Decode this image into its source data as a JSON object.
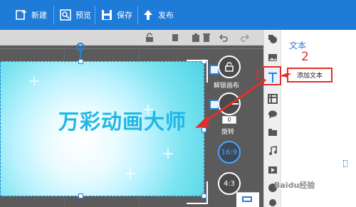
{
  "toolbar": {
    "new_label": "新建",
    "preview_label": "预览",
    "save_label": "保存",
    "publish_label": "发布",
    "bg_color": "#1e7bd8"
  },
  "canvas": {
    "title_text": "万彩动画大师",
    "title_color": "#20b7e3"
  },
  "controls": {
    "unlock_canvas_label": "解锁画布",
    "rotate_value": "0",
    "rotate_label": "旋转",
    "ratio_16_9": "16:9",
    "ratio_4_3": "4:3"
  },
  "panel": {
    "title": "文本",
    "add_text_label": "添加文本"
  },
  "annotations": {
    "num1": "1",
    "num2": "2",
    "color": "#e0302b"
  },
  "watermark": "Baidu经验",
  "icons": [
    "new-icon",
    "preview-icon",
    "save-icon",
    "publish-icon",
    "lock-icon",
    "copy-icon",
    "paste-icon",
    "delete-icon",
    "undo-icon",
    "redo-icon",
    "shape-icon",
    "image-icon",
    "text-icon",
    "table-icon",
    "bubble-icon",
    "folder-icon",
    "music-icon",
    "video-icon",
    "special-icon"
  ]
}
